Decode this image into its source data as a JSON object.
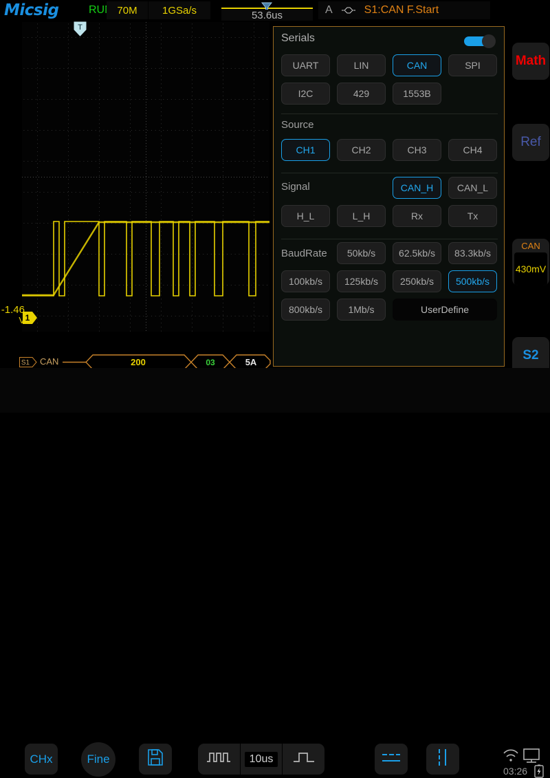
{
  "header": {
    "logo": "Micsig",
    "run_state": "RUN",
    "memory_depth": "70M",
    "sample_rate": "1GSa/s",
    "time_offset": "53.6us",
    "trigger_source_letter": "A",
    "trigger_label": "S1:CAN F.Start",
    "trigger_icon": "trigger-hexagon-icon",
    "timeref_marker_icon": "trigger-position-marker-icon"
  },
  "waveform": {
    "channel_voltage": "-1.46",
    "channel_voltage_unit": "V",
    "channel_number": "1",
    "trigger_marker_letter": "T",
    "decode": {
      "source_badge": "S1",
      "protocol_label": "CAN",
      "packets": [
        {
          "value": "200",
          "color": "#e8d200"
        },
        {
          "value": "03",
          "color": "#3ad03a"
        },
        {
          "value": "5A",
          "color": "#e8e8e8"
        }
      ]
    }
  },
  "panel": {
    "title": "Serials",
    "enabled_toggle": true,
    "protocols": [
      "UART",
      "LIN",
      "CAN",
      "SPI",
      "I2C",
      "429",
      "1553B"
    ],
    "protocol_selected": "CAN",
    "source_label": "Source",
    "sources": [
      "CH1",
      "CH2",
      "CH3",
      "CH4"
    ],
    "source_selected": "CH1",
    "signal_label": "Signal",
    "signals": [
      "CAN_H",
      "CAN_L",
      "H_L",
      "L_H",
      "Rx",
      "Tx"
    ],
    "signal_selected": "CAN_H",
    "baudrate_label": "BaudRate",
    "baudrates": [
      "50kb/s",
      "62.5kb/s",
      "83.3kb/s",
      "100kb/s",
      "125kb/s",
      "250kb/s",
      "500kb/s",
      "800kb/s",
      "1Mb/s"
    ],
    "baudrate_selected": "500kb/s",
    "userdefine_label": "UserDefine"
  },
  "sidebar": {
    "math_label": "Math",
    "ref_label": "Ref",
    "can_widget_title": "CAN",
    "can_widget_value": "430mV",
    "s2_label": "S2"
  },
  "bottombar": {
    "chx_label": "CHx",
    "fine_label": "Fine",
    "save_icon": "save-disk-icon",
    "pulse_train_icon": "pulse-train-icon",
    "timebase_value": "10us",
    "single_pulse_icon": "single-pulse-icon",
    "h_cursor_icon": "horizontal-cursor-icon",
    "v_cursor_icon": "vertical-cursor-icon",
    "wifi_icon": "wifi-icon",
    "display_icon": "monitor-icon",
    "battery_icon": "battery-charging-icon",
    "clock": "03:26"
  },
  "colors": {
    "brand": "#1a8fe0",
    "accent_blue": "#1a9fe8",
    "channel_yellow": "#e8d200",
    "decode_orange": "#e08214",
    "run_green": "#15d015",
    "math_red": "#ee0000"
  }
}
